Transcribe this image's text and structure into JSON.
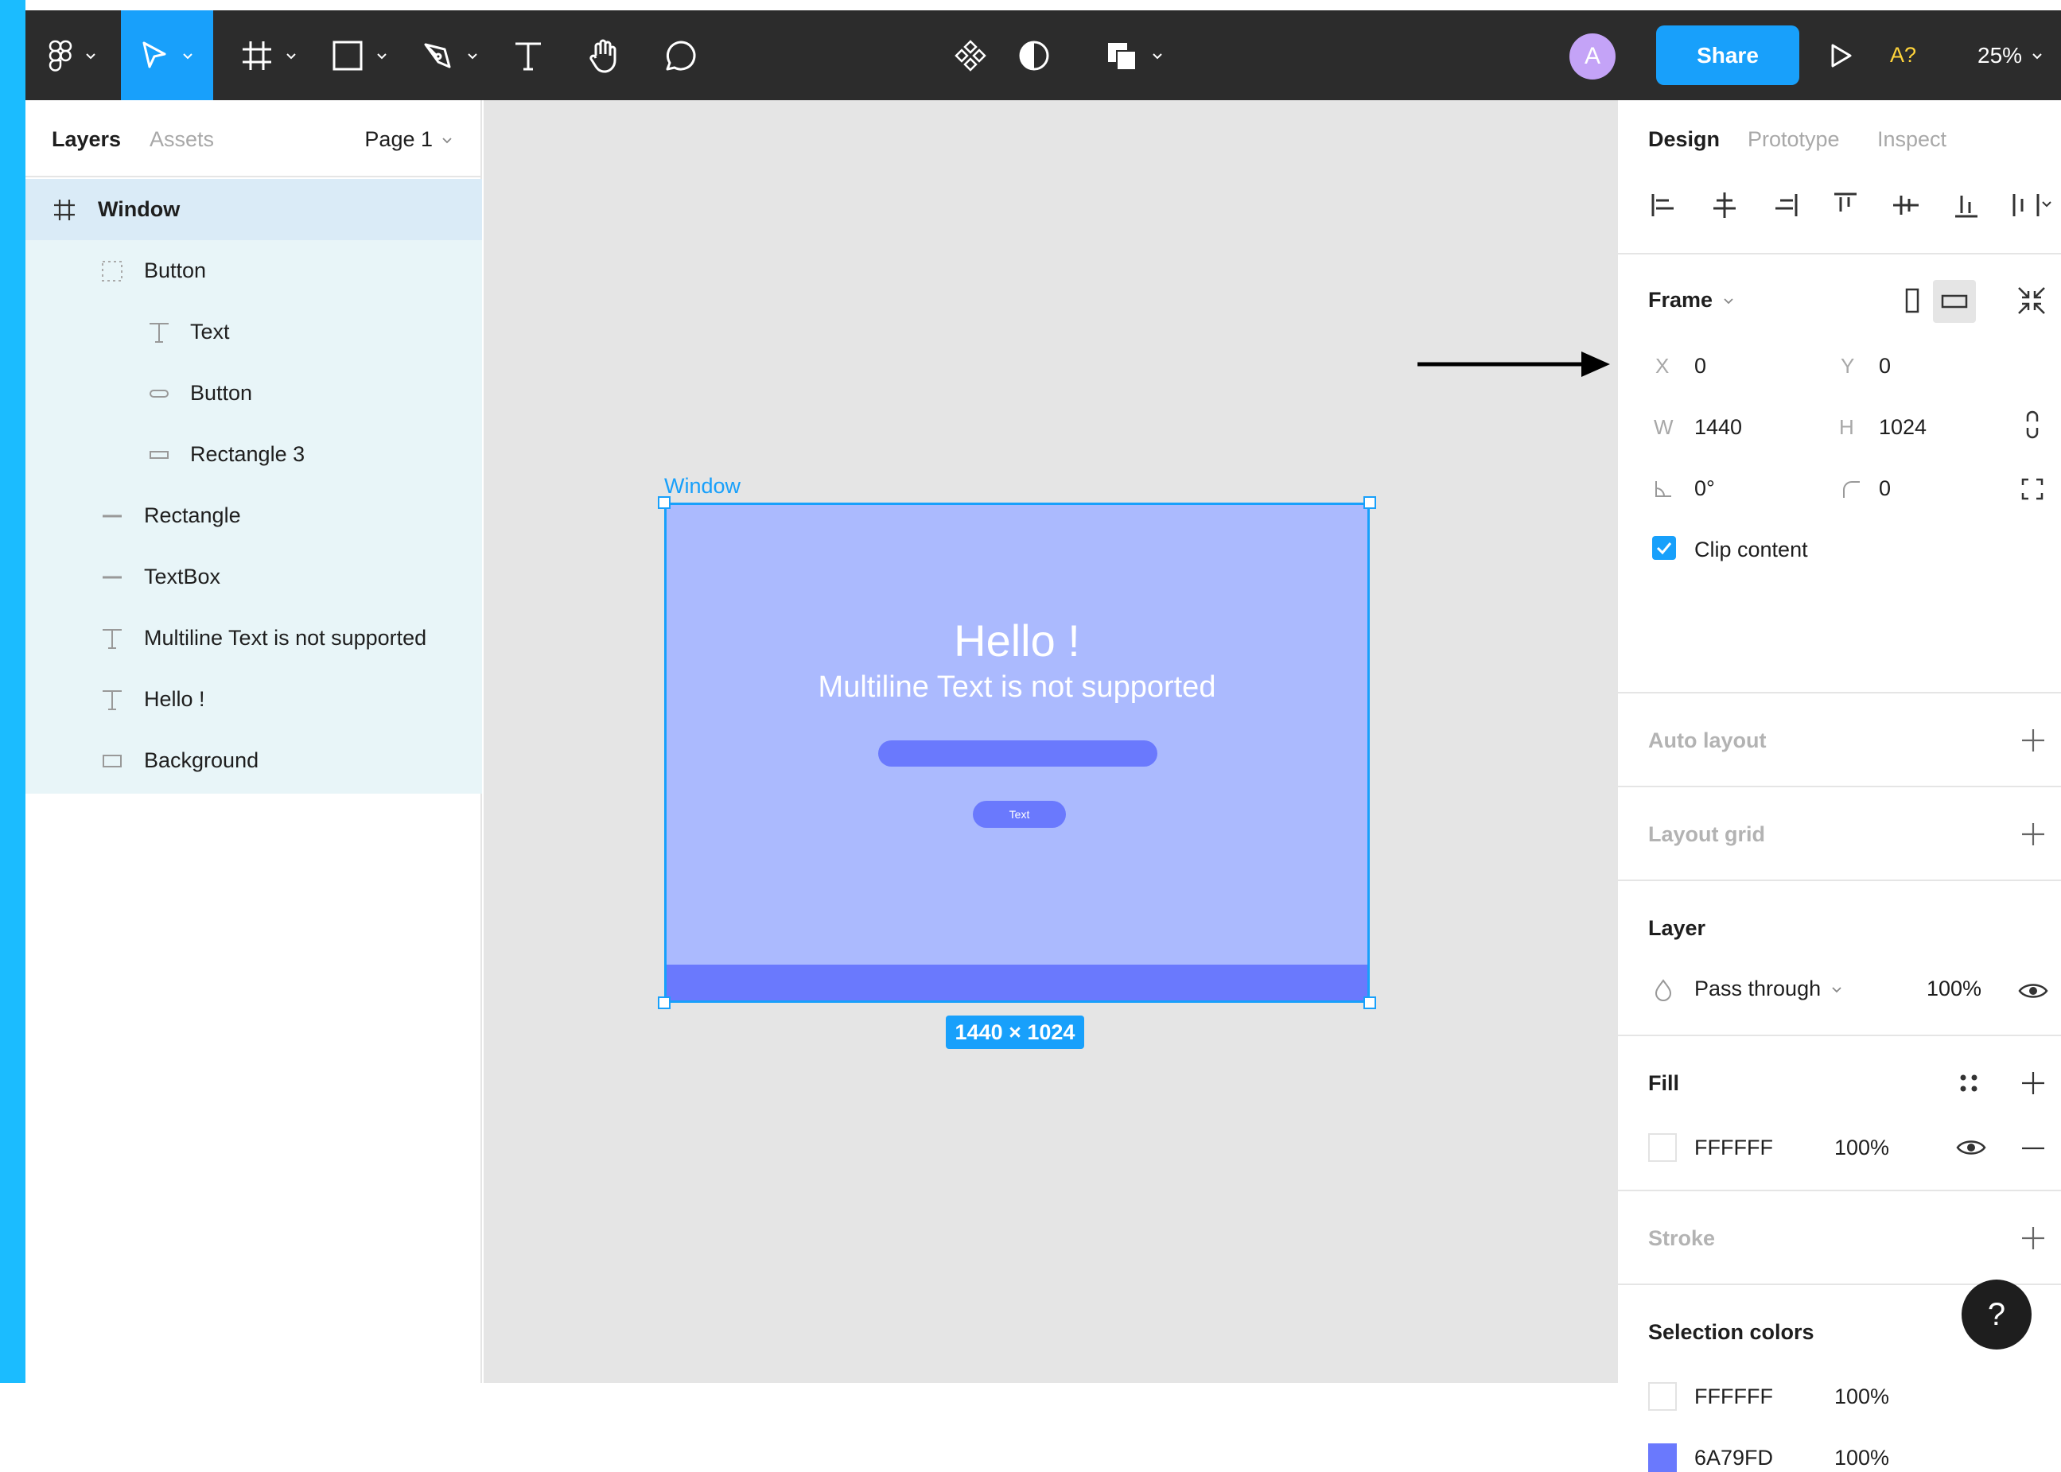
{
  "toolbar": {
    "share_label": "Share",
    "avatar_initial": "A",
    "missing_fonts_label": "A?",
    "zoom_label": "25%"
  },
  "left_panel": {
    "tabs": [
      {
        "label": "Layers"
      },
      {
        "label": "Assets"
      }
    ],
    "page_selector": "Page 1",
    "layers": [
      {
        "label": "Window",
        "icon": "frame-icon"
      },
      {
        "label": "Button",
        "icon": "component-group-icon"
      },
      {
        "label": "Text",
        "icon": "text-icon"
      },
      {
        "label": "Button",
        "icon": "rectangle-icon"
      },
      {
        "label": "Rectangle 3",
        "icon": "rectangle-icon"
      },
      {
        "label": "Rectangle",
        "icon": "line-icon"
      },
      {
        "label": "TextBox",
        "icon": "line-icon"
      },
      {
        "label": "Multiline Text is not supported",
        "icon": "text-icon"
      },
      {
        "label": "Hello !",
        "icon": "text-icon"
      },
      {
        "label": "Background",
        "icon": "rectangle-icon"
      }
    ]
  },
  "canvas": {
    "frame_name": "Window",
    "hello_text": "Hello !",
    "multiline_text": "Multiline Text is not supported",
    "button_text": "Text",
    "dimensions_label": "1440 × 1024",
    "frame_color": "#ABBAFE",
    "accent_color": "#6A79FD"
  },
  "right_panel": {
    "tabs": [
      {
        "label": "Design"
      },
      {
        "label": "Prototype"
      },
      {
        "label": "Inspect"
      }
    ],
    "frame": {
      "title": "Frame",
      "x_label": "X",
      "x_value": "0",
      "y_label": "Y",
      "y_value": "0",
      "w_label": "W",
      "w_value": "1440",
      "h_label": "H",
      "h_value": "1024",
      "rotation_value": "0°",
      "radius_value": "0",
      "clip_content_label": "Clip content",
      "clip_content_checked": true
    },
    "auto_layout_title": "Auto layout",
    "layout_grid_title": "Layout grid",
    "layer": {
      "title": "Layer",
      "blend_mode": "Pass through",
      "opacity": "100%"
    },
    "fill": {
      "title": "Fill",
      "hex": "FFFFFF",
      "opacity": "100%"
    },
    "stroke_title": "Stroke",
    "selection_colors": {
      "title": "Selection colors",
      "items": [
        {
          "hex": "FFFFFF",
          "opacity": "100%",
          "swatch": "#FFFFFF"
        },
        {
          "hex": "6A79FD",
          "opacity": "100%",
          "swatch": "#6A79FD"
        }
      ]
    },
    "help_label": "?"
  }
}
